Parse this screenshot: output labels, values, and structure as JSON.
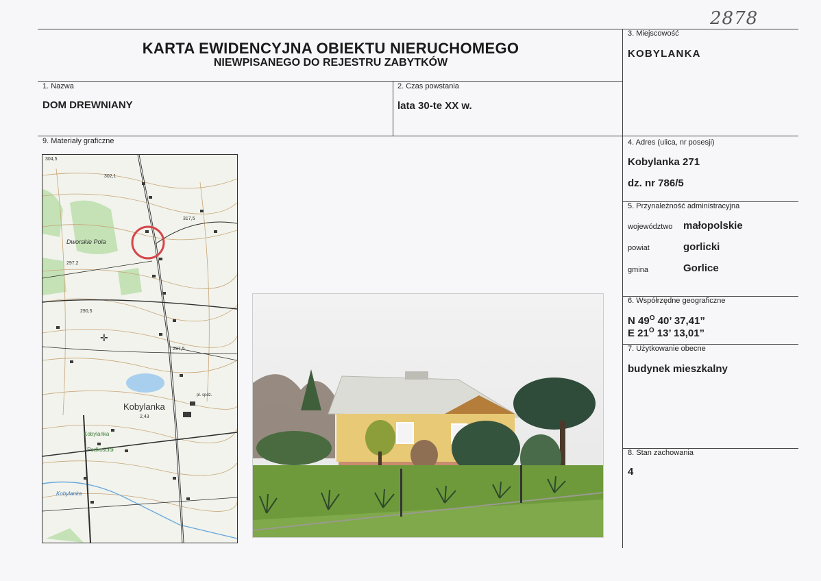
{
  "catalog_number": "2878",
  "header": {
    "title": "KARTA EWIDENCYJNA OBIEKTU NIERUCHOMEGO",
    "subtitle": "NIEWPISANEGO DO REJESTRU ZABYTKÓW"
  },
  "fields": {
    "name": {
      "label": "1. Nazwa",
      "value": "DOM DREWNIANY"
    },
    "period": {
      "label": "2. Czas powstania",
      "value": "lata 30-te XX w."
    },
    "locality": {
      "label": "3. Miejscowość",
      "value": "KOBYLANKA"
    },
    "address": {
      "label": "4. Adres (ulica, nr posesji)",
      "line1": "Kobylanka 271",
      "line2": "dz. nr 786/5"
    },
    "admin": {
      "label": "5. Przynależność administracyjna",
      "voivodeship_label": "województwo",
      "voivodeship": "małopolskie",
      "county_label": "powiat",
      "county": "gorlicki",
      "commune_label": "gmina",
      "commune": "Gorlice"
    },
    "coords": {
      "label": "6. Współrzędne geograficzne",
      "n_prefix": "N 49",
      "n_deg": "O",
      "n_rest": " 40’ 37,41”",
      "e_prefix": "E 21",
      "e_deg": "O",
      "e_rest": " 13’ 13,01”"
    },
    "usage": {
      "label": "7. Użytkowanie obecne",
      "value": "budynek mieszkalny"
    },
    "condition": {
      "label": "8. Stan zachowania",
      "value": "4"
    },
    "graphics": {
      "label": "9. Materiały graficzne"
    }
  },
  "map": {
    "labels": {
      "dworskie_pola": "Dworskie Pola",
      "kobylanka": "Kobylanka",
      "kobylanka_small": "Kobylanka",
      "podkosciol": "Podkościół",
      "kobylanka_river": "Kobylanka",
      "pl_spdz": "pl. spdz.",
      "h1": "317,5",
      "h2": "302,1",
      "h3": "297,2",
      "h4": "290,5",
      "h5": "297,5",
      "h6": "2,43",
      "h7": "304,5"
    },
    "colors": {
      "road": "#2e2e2e",
      "contour": "#c8a070",
      "forest": "#bfe0b0",
      "water": "#a9cfee",
      "marker": "#d6454a"
    }
  }
}
